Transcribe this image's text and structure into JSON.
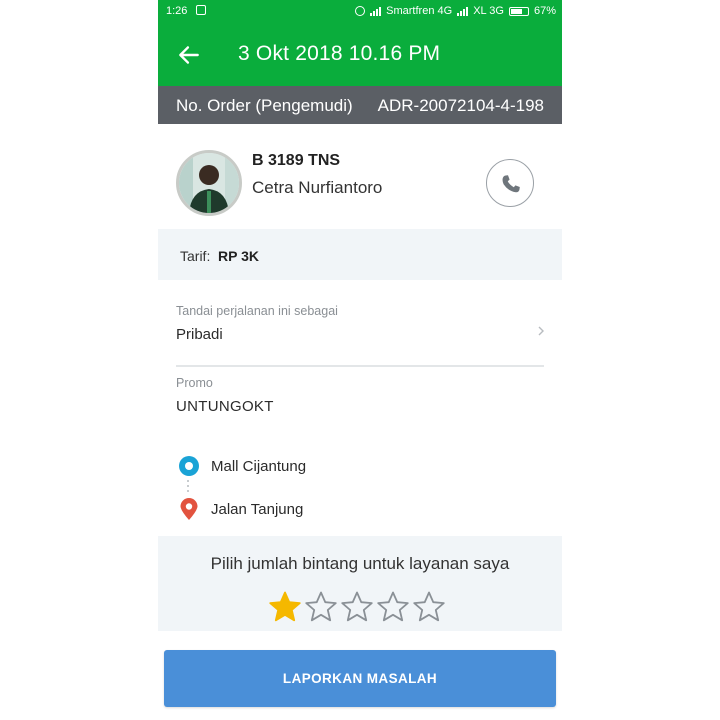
{
  "status_bar": {
    "time": "1:26",
    "carrier_1": "Smartfren 4G",
    "carrier_2": "XL 3G",
    "battery": "67%",
    "battery_level": 0.67
  },
  "app_bar": {
    "title": "3 Okt 2018 10.16 PM",
    "back_icon": "arrow-left-icon"
  },
  "order": {
    "label": "No. Order (Pengemudi)",
    "number": "ADR-20072104-4-198"
  },
  "driver": {
    "plate": "B 3189 TNS",
    "name": "Cetra Nurfiantoro",
    "call_icon": "phone-icon"
  },
  "tarif": {
    "label": "Tarif:",
    "value": "RP 3K"
  },
  "trip_tag": {
    "caption": "Tandai perjalanan ini sebagai",
    "value": "Pribadi"
  },
  "promo": {
    "caption": "Promo",
    "value": "UNTUNGOKT"
  },
  "route": {
    "origin": "Mall Cijantung",
    "destination": "Jalan Tanjung"
  },
  "rating": {
    "prompt": "Pilih jumlah bintang untuk layanan saya",
    "selected": 1,
    "max": 5
  },
  "report_button": {
    "label": "LAPORKAN MASALAH"
  },
  "colors": {
    "header_green": "#0aad3c",
    "order_bar": "#5b5f65",
    "panel_bg": "#f1f5f8",
    "report_blue": "#4a8fd8",
    "star_filled": "#f5b800",
    "origin_blue": "#1aa3d6",
    "destination_red": "#e2533f"
  }
}
